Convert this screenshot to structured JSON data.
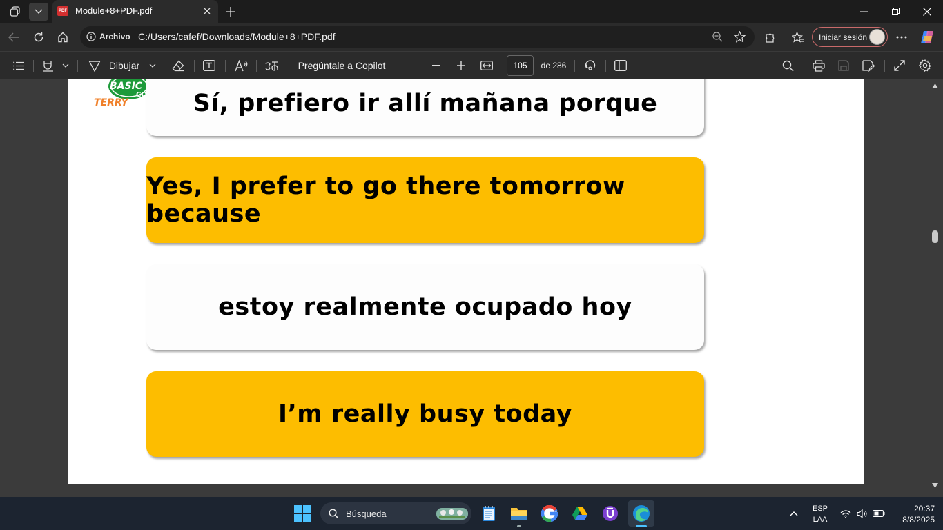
{
  "browser": {
    "tab_title": "Module+8+PDF.pdf",
    "pdf_badge": "PDF",
    "address_label": "Archivo",
    "url": "C:/Users/cafef/Downloads/Module+8+PDF.pdf",
    "signin_label": "Iniciar sesión"
  },
  "pdf_toolbar": {
    "draw_label": "Dibujar",
    "copilot_label": "Pregúntale a Copilot",
    "page_number": "105",
    "page_total": "de 286"
  },
  "document": {
    "logo_text_top": "BASIC",
    "logo_text_side": "CO",
    "logo_text_bottom": "TERRY",
    "cards": [
      {
        "text": "Sí, prefiero ir allí mañana porque",
        "style": "white"
      },
      {
        "text": "Yes, I prefer to go there tomorrow because",
        "style": "yellow"
      },
      {
        "text": "estoy realmente ocupado hoy",
        "style": "white"
      },
      {
        "text": "I’m really busy today",
        "style": "yellow"
      }
    ],
    "colors": {
      "yellow_card": "#fdbd00",
      "white_card": "#fdfdfd"
    }
  },
  "taskbar": {
    "search_placeholder": "Búsqueda",
    "language_top": "ESP",
    "language_bottom": "LAA",
    "time": "20:37",
    "date": "8/8/2025"
  }
}
